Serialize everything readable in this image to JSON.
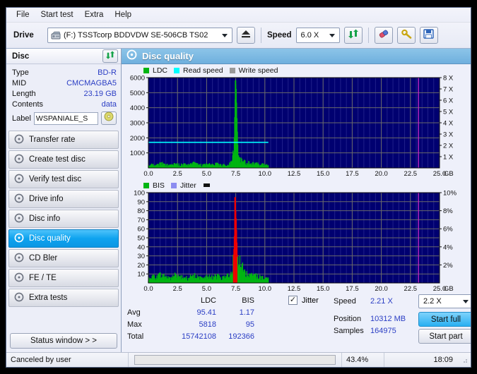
{
  "menu": {
    "items": [
      {
        "label": "File"
      },
      {
        "label": "Start test"
      },
      {
        "label": "Extra"
      },
      {
        "label": "Help"
      }
    ]
  },
  "toolbar": {
    "drive_label": "Drive",
    "drive_value": "(F:)  TSSTcorp BDDVDW SE-506CB TS02",
    "eject_icon": "eject-icon",
    "speed_label": "Speed",
    "speed_value": "6.0 X",
    "refresh_icon": "refresh-icon",
    "erase_icon": "erase-icon",
    "settings_icon": "settings-icon",
    "save_icon": "save-icon",
    "drive_icon": "drive-icon"
  },
  "sidebar": {
    "panel_title": "Disc",
    "panel_refresh_icon": "refresh-icon",
    "disc_info": [
      {
        "key": "Type",
        "value": "BD-R"
      },
      {
        "key": "MID",
        "value": "CMCMAGBA5"
      },
      {
        "key": "Length",
        "value": "23.19 GB"
      },
      {
        "key": "Contents",
        "value": "data"
      }
    ],
    "label_key": "Label",
    "label_value": "WSPANIALE_S",
    "label_icon": "disc-icon",
    "items": [
      {
        "label": "Transfer rate",
        "icon": "disc-test-icon",
        "selected": false
      },
      {
        "label": "Create test disc",
        "icon": "disc-burn-icon",
        "selected": false
      },
      {
        "label": "Verify test disc",
        "icon": "disc-verify-icon",
        "selected": false
      },
      {
        "label": "Drive info",
        "icon": "drive-info-icon",
        "selected": false
      },
      {
        "label": "Disc info",
        "icon": "disc-info-icon",
        "selected": false
      },
      {
        "label": "Disc quality",
        "icon": "disc-quality-icon",
        "selected": true
      },
      {
        "label": "CD Bler",
        "icon": "cd-bler-icon",
        "selected": false
      },
      {
        "label": "FE / TE",
        "icon": "fe-te-icon",
        "selected": false
      },
      {
        "label": "Extra tests",
        "icon": "extra-tests-icon",
        "selected": false
      }
    ],
    "status_window_button": "Status window > >"
  },
  "main": {
    "title": "Disc quality",
    "title_icon": "disc-quality-icon"
  },
  "stats": {
    "col_headers": [
      "LDC",
      "BIS"
    ],
    "rows": [
      {
        "label": "Avg",
        "ldc": "95.41",
        "bis": "1.17"
      },
      {
        "label": "Max",
        "ldc": "5818",
        "bis": "95"
      },
      {
        "label": "Total",
        "ldc": "15742108",
        "bis": "192366"
      }
    ],
    "jitter_label": "Jitter",
    "jitter_checked": true,
    "jitter_check_glyph": "✓"
  },
  "controls": {
    "speed_label": "Speed",
    "speed_value": "2.21 X",
    "speed_select": "2.2 X",
    "position_label": "Position",
    "position_value": "10312 MB",
    "samples_label": "Samples",
    "samples_value": "164975",
    "start_full_label": "Start full",
    "start_part_label": "Start part"
  },
  "statusbar": {
    "message": "Canceled by user",
    "progress_text": "43.4%",
    "progress_percent": 43.4,
    "time": "18:09"
  },
  "colors": {
    "ldc": "#00b512",
    "read_speed": "#00ffff",
    "write_speed": "#9a9a9a",
    "bis": "#00b512",
    "jitter": "#8c8cf0",
    "spike": "#ef0000",
    "plot_bg": "#000070",
    "capacity_marker": "#c828c8",
    "accent": "#0ea3ef",
    "value_text": "#2b3ec4",
    "progress": "#ece400"
  },
  "chart_data": [
    {
      "type": "area",
      "name": "LDC / Read speed",
      "title": "Disc quality",
      "xlabel": "GB",
      "ylabel": "LDC",
      "y2label": "X",
      "xlim": [
        0,
        25.0
      ],
      "ylim": [
        0,
        6000
      ],
      "y2lim": [
        0,
        8
      ],
      "xticks": [
        "0.0",
        "2.5",
        "5.0",
        "7.5",
        "10.0",
        "12.5",
        "15.0",
        "17.5",
        "20.0",
        "22.5",
        "25.0"
      ],
      "xtick_suffix": "GB",
      "yticks": [
        1000,
        2000,
        3000,
        4000,
        5000,
        6000
      ],
      "y2ticks": [
        "1 X",
        "2 X",
        "3 X",
        "4 X",
        "5 X",
        "6 X",
        "7 X",
        "8 X"
      ],
      "grid": true,
      "legend": [
        {
          "label": "LDC",
          "color": "#00b512"
        },
        {
          "label": "Read speed",
          "color": "#00ffff"
        },
        {
          "label": "Write speed",
          "color": "#9a9a9a"
        }
      ],
      "annotations": [
        {
          "label": "disc capacity marker",
          "x": 23.19,
          "color": "#c828c8"
        }
      ],
      "series": [
        {
          "name": "LDC",
          "color": "#00b512",
          "x": [
            0.0,
            0.3,
            0.7,
            1.1,
            1.5,
            1.9,
            2.3,
            2.7,
            3.1,
            3.5,
            3.9,
            4.3,
            4.7,
            5.1,
            5.5,
            5.9,
            6.3,
            6.7,
            7.0,
            7.2,
            7.35,
            7.42,
            7.48,
            7.55,
            7.62,
            7.7,
            7.8,
            7.9,
            8.1,
            8.4,
            8.8,
            9.2,
            9.6,
            10.0,
            10.3
          ],
          "values": [
            120,
            190,
            150,
            260,
            180,
            150,
            230,
            170,
            200,
            160,
            290,
            180,
            150,
            210,
            170,
            230,
            160,
            190,
            260,
            330,
            1200,
            3900,
            5818,
            5200,
            3100,
            1100,
            520,
            430,
            380,
            300,
            260,
            230,
            200,
            180,
            140
          ]
        },
        {
          "name": "Read speed",
          "color": "#00ffff",
          "x": [
            0.0,
            5.0,
            10.0,
            10.3
          ],
          "values": [
            1700,
            1700,
            1700,
            1700
          ],
          "note": "flat line, about 2.2X on right axis"
        },
        {
          "name": "Write speed",
          "color": "#9a9a9a",
          "x": [],
          "values": [],
          "note": "not plotted"
        }
      ]
    },
    {
      "type": "area",
      "name": "BIS / Jitter",
      "xlabel": "GB",
      "ylabel": "BIS",
      "y2label": "%",
      "xlim": [
        0,
        25.0
      ],
      "ylim": [
        0,
        100
      ],
      "y2lim": [
        0,
        10
      ],
      "xticks": [
        "0.0",
        "2.5",
        "5.0",
        "7.5",
        "10.0",
        "12.5",
        "15.0",
        "17.5",
        "20.0",
        "22.5",
        "25.0"
      ],
      "xtick_suffix": "GB",
      "yticks": [
        10,
        20,
        30,
        40,
        50,
        60,
        70,
        80,
        90,
        100
      ],
      "y2ticks": [
        "2%",
        "4%",
        "6%",
        "8%",
        "10%"
      ],
      "grid": true,
      "legend": [
        {
          "label": "BIS",
          "color": "#00b512"
        },
        {
          "label": "Jitter",
          "color": "#8c8cf0"
        }
      ],
      "annotations": [
        {
          "label": "disc capacity marker",
          "x": 23.19,
          "color": "#c828c8"
        }
      ],
      "series": [
        {
          "name": "BIS",
          "color": "#00b512",
          "x": [
            0.0,
            0.3,
            0.7,
            1.1,
            1.5,
            1.9,
            2.3,
            2.7,
            3.1,
            3.5,
            3.9,
            4.3,
            4.7,
            5.1,
            5.5,
            5.9,
            6.3,
            6.7,
            7.0,
            7.2,
            7.35,
            7.45,
            7.55,
            7.65,
            7.75,
            7.9,
            8.0,
            8.2,
            8.4,
            8.7,
            9.0,
            9.4,
            9.8,
            10.2,
            10.3
          ],
          "values": [
            4,
            6,
            5,
            8,
            5,
            4,
            7,
            5,
            6,
            4,
            9,
            5,
            4,
            6,
            5,
            7,
            5,
            6,
            8,
            12,
            40,
            95,
            70,
            30,
            14,
            22,
            18,
            12,
            9,
            8,
            7,
            6,
            5,
            4,
            4
          ]
        },
        {
          "name": "Jitter",
          "color": "#8c8cf0",
          "x": [],
          "values": [],
          "note": "not plotted"
        }
      ]
    }
  ]
}
